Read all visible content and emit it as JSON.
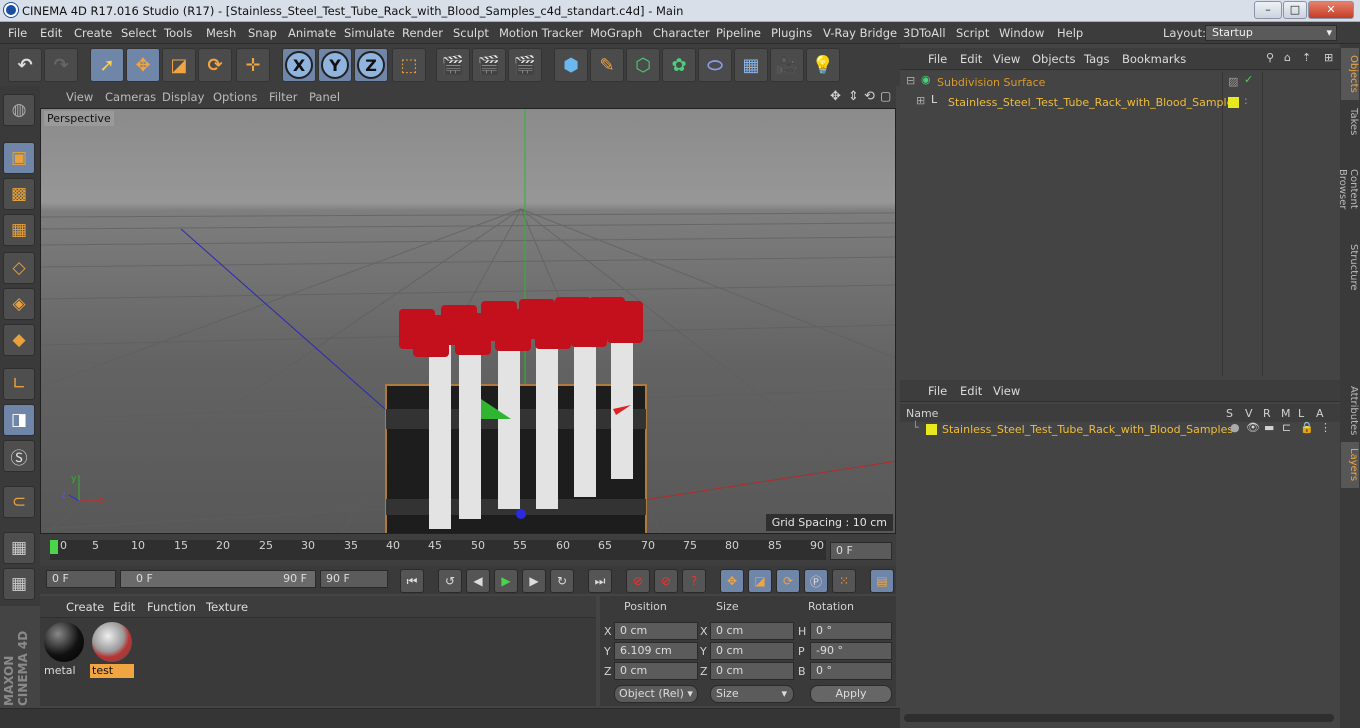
{
  "window": {
    "title": "CINEMA 4D R17.016 Studio (R17) - [Stainless_Steel_Test_Tube_Rack_with_Blood_Samples_c4d_standart.c4d] - Main",
    "minimize": "–",
    "maximize": "□",
    "close": "✕"
  },
  "menubar": {
    "items": [
      "File",
      "Edit",
      "Create",
      "Select",
      "Tools",
      "Mesh",
      "Snap",
      "Animate",
      "Simulate",
      "Render",
      "Sculpt",
      "Motion Tracker",
      "MoGraph",
      "Character",
      "Pipeline",
      "Plugins",
      "V-Ray Bridge",
      "3DToAll",
      "Script",
      "Window",
      "Help"
    ],
    "layout_label": "Layout:",
    "layout_value": "Startup"
  },
  "viewport": {
    "menu": [
      "View",
      "Cameras",
      "Display",
      "Options",
      "Filter",
      "Panel"
    ],
    "camera_label": "Perspective",
    "grid_spacing": "Grid Spacing : 10 cm"
  },
  "timeline": {
    "ticks": [
      "0",
      "5",
      "10",
      "15",
      "20",
      "25",
      "30",
      "35",
      "40",
      "45",
      "50",
      "55",
      "60",
      "65",
      "70",
      "75",
      "80",
      "85",
      "90"
    ],
    "end_frame": "0 F"
  },
  "playback": {
    "current": "0 F",
    "range_start": "0 F",
    "range_end": "90 F",
    "max": "90 F"
  },
  "materials": {
    "menu": [
      "Create",
      "Edit",
      "Function",
      "Texture"
    ],
    "items": [
      {
        "name": "metal"
      },
      {
        "name": "test"
      }
    ]
  },
  "attributes": {
    "headers": [
      "Position",
      "Size",
      "Rotation"
    ],
    "rows": [
      {
        "pos_axis": "X",
        "pos": "0 cm",
        "size_axis": "X",
        "size": "0 cm",
        "rot_axis": "H",
        "rot": "0 °"
      },
      {
        "pos_axis": "Y",
        "pos": "6.109 cm",
        "size_axis": "Y",
        "size": "0 cm",
        "rot_axis": "P",
        "rot": "-90 °"
      },
      {
        "pos_axis": "Z",
        "pos": "0 cm",
        "size_axis": "Z",
        "size": "0 cm",
        "rot_axis": "B",
        "rot": "0 °"
      }
    ],
    "mode_select": "Object (Rel)",
    "size_select": "Size",
    "apply": "Apply"
  },
  "objects": {
    "menu": [
      "File",
      "Edit",
      "View",
      "Objects",
      "Tags",
      "Bookmarks"
    ],
    "items": [
      {
        "name": "Subdivision Surface"
      },
      {
        "name": "Stainless_Steel_Test_Tube_Rack_with_Blood_Samples"
      }
    ]
  },
  "layers": {
    "menu": [
      "File",
      "Edit",
      "View"
    ],
    "columns": [
      "Name",
      "S",
      "V",
      "R",
      "M",
      "L",
      "A"
    ],
    "items": [
      {
        "name": "Stainless_Steel_Test_Tube_Rack_with_Blood_Samples"
      }
    ]
  },
  "right_tabs": [
    "Objects",
    "Takes",
    "Content Browser",
    "Structure",
    "Attributes",
    "Layers"
  ],
  "brand": {
    "logo_text": "MAXON CINEMA 4D"
  },
  "colors": {
    "accent": "#f0bd3a",
    "selected": "#6f86a8",
    "tube_cap": "#c4101c"
  }
}
